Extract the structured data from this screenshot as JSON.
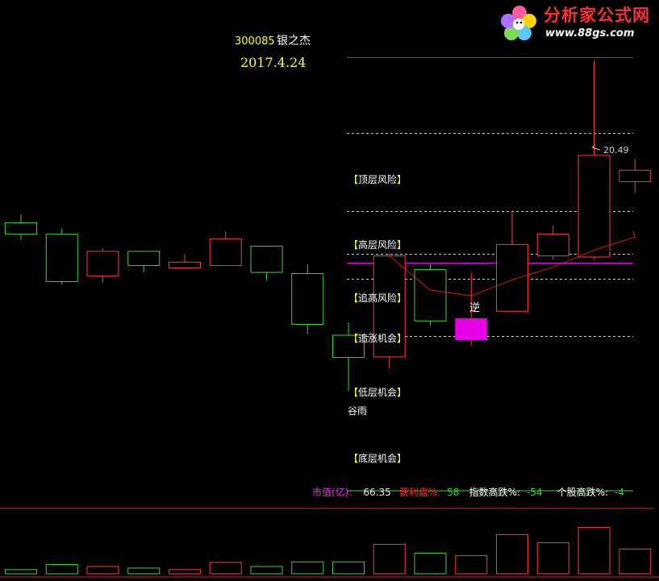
{
  "logo": {
    "name": "分析家公式网",
    "url": "www.88gs.com"
  },
  "header": {
    "code": "300085",
    "name": "银之杰",
    "date": "2017.4.24"
  },
  "zones": [
    "顶层风险",
    "高层风险",
    "追高风险",
    "追涨机会",
    "低层机会",
    "底层机会"
  ],
  "annotations": {
    "peak_value": "20.49",
    "ni": "逆",
    "guyu": "谷雨"
  },
  "info": {
    "mv_label": "市值(亿):",
    "mv_value": "66.35",
    "profit_label": "获利盘%:",
    "profit_value": "58",
    "index_label": "指数高跌%:",
    "index_value": "-54",
    "stock_label": "个股高跌%:",
    "stock_value": "-4"
  },
  "colors": {
    "up": "#ff3b3b",
    "down": "#3bd23b",
    "highlight": "#e600e6",
    "zone_label": "#ffff00",
    "ma": "#e01a1a"
  },
  "chart_data": {
    "type": "candlestick",
    "price_ylim": [
      12.8,
      21.2
    ],
    "candles": [
      {
        "open": 17.45,
        "close": 17.65,
        "high": 17.8,
        "low": 17.35,
        "dir": "down"
      },
      {
        "open": 17.45,
        "close": 16.62,
        "high": 17.55,
        "low": 16.57,
        "dir": "down"
      },
      {
        "open": 16.72,
        "close": 17.15,
        "high": 17.2,
        "low": 16.6,
        "dir": "up"
      },
      {
        "open": 17.15,
        "close": 16.9,
        "high": 17.15,
        "low": 16.78,
        "dir": "down"
      },
      {
        "open": 16.86,
        "close": 16.96,
        "high": 17.1,
        "low": 16.86,
        "dir": "up"
      },
      {
        "open": 16.9,
        "close": 17.37,
        "high": 17.5,
        "low": 16.9,
        "dir": "up"
      },
      {
        "open": 17.24,
        "close": 16.78,
        "high": 17.24,
        "low": 16.64,
        "dir": "down"
      },
      {
        "open": 16.76,
        "close": 15.87,
        "high": 16.92,
        "low": 15.7,
        "dir": "down"
      },
      {
        "open": 15.68,
        "close": 15.29,
        "high": 15.9,
        "low": 14.7,
        "dir": "down"
      },
      {
        "open": 15.3,
        "close": 17.07,
        "high": 17.12,
        "low": 15.1,
        "dir": "up"
      },
      {
        "open": 16.83,
        "close": 15.93,
        "high": 16.93,
        "low": 15.85,
        "dir": "down"
      },
      {
        "open": 15.97,
        "close": 15.6,
        "high": 16.77,
        "low": 15.5,
        "dir": "up",
        "highlight": true
      },
      {
        "open": 16.1,
        "close": 17.27,
        "high": 17.87,
        "low": 16.1,
        "dir": "up"
      },
      {
        "open": 17.07,
        "close": 17.45,
        "high": 17.6,
        "low": 17.0,
        "dir": "up"
      },
      {
        "open": 17.05,
        "close": 18.83,
        "high": 20.49,
        "low": 17.0,
        "dir": "up"
      },
      {
        "open": 18.37,
        "close": 18.57,
        "high": 18.77,
        "low": 18.17,
        "dir": "up"
      }
    ],
    "ma": [
      null,
      null,
      null,
      null,
      null,
      null,
      null,
      null,
      null,
      17.07,
      16.47,
      16.37,
      16.65,
      16.87,
      17.17,
      17.4
    ],
    "zone_levels": [
      20.55,
      19.22,
      17.85,
      17.1,
      16.67,
      15.67
    ],
    "reference_level": 16.95,
    "volume": [
      0.08,
      0.18,
      0.14,
      0.11,
      0.08,
      0.22,
      0.14,
      0.23,
      0.23,
      0.57,
      0.4,
      0.35,
      0.76,
      0.6,
      0.9,
      0.48
    ],
    "volume_dir": [
      "down",
      "down",
      "up",
      "down",
      "up",
      "up",
      "down",
      "down",
      "down",
      "up",
      "down",
      "up",
      "up",
      "up",
      "up",
      "up"
    ]
  }
}
